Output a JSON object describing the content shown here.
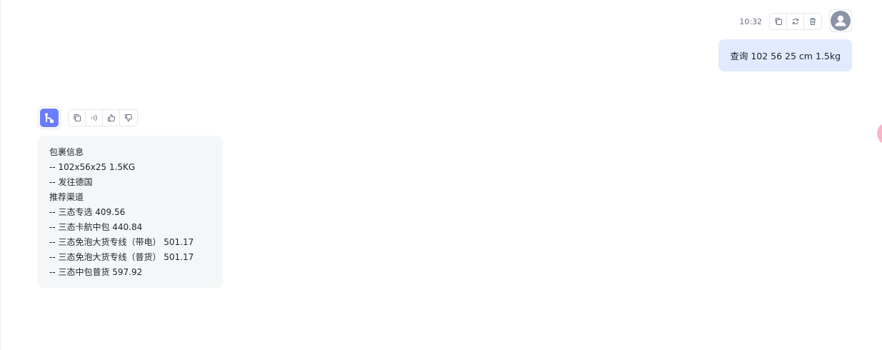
{
  "user_message": {
    "time": "10:32",
    "text": "查询 102 56 25 cm 1.5kg",
    "actions": [
      "copy-icon",
      "refresh-icon",
      "trash-icon"
    ]
  },
  "bot_message": {
    "actions": [
      "copy-icon",
      "speaker-icon",
      "thumbs-up-icon",
      "thumbs-down-icon"
    ],
    "lines": [
      "包裹信息",
      "-- 102x56x25 1.5KG",
      "-- 发往德国",
      "推荐渠道",
      "-- 三态专选 409.56",
      "-- 三态卡航中包 440.84",
      "-- 三态免泡大货专线（带电） 501.17",
      "-- 三态免泡大货专线（普货） 501.17",
      "-- 三态中包普货 597.92"
    ]
  },
  "colors": {
    "user_bubble": "#e1eaff",
    "bot_bubble": "#f4f6f8",
    "bot_avatar": "#6b7cff",
    "float_button": "#f7b6c8"
  }
}
